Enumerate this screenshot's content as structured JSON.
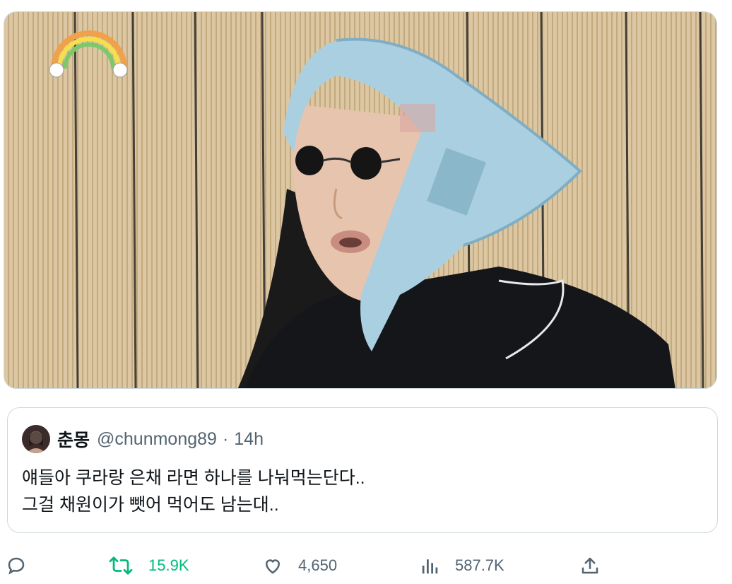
{
  "media": {
    "logo_text": "",
    "description_icon": "video-still-image"
  },
  "quoted_tweet": {
    "display_name": "춘몽",
    "handle": "@chunmong89",
    "separator": "·",
    "time": "14h",
    "text_lines": [
      "얘들아 쿠라랑 은채 라면 하나를 나눠먹는단다..",
      "그걸 채원이가 뺏어 먹어도 남는대.."
    ]
  },
  "actions": {
    "reply": {
      "icon": "reply-icon",
      "count": ""
    },
    "retweet": {
      "icon": "retweet-icon",
      "count": "15.9K",
      "color": "#00ba7c"
    },
    "like": {
      "icon": "heart-icon",
      "count": "4,650"
    },
    "views": {
      "icon": "views-icon",
      "count": "587.7K"
    },
    "share": {
      "icon": "share-icon",
      "count": ""
    }
  },
  "colors": {
    "border": "#cfd9de",
    "secondary_text": "#536471",
    "retweet_green": "#00ba7c",
    "bamboo_blind": "#d9c49e",
    "scarf": "#a9cfe0",
    "jacket": "#15161a"
  }
}
